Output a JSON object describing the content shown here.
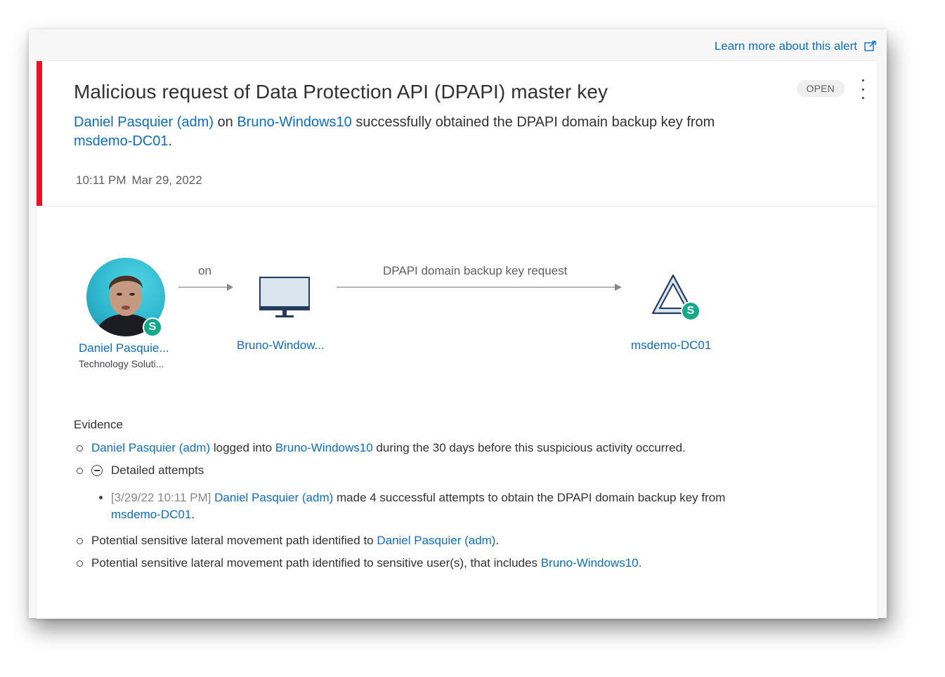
{
  "learn_more": {
    "label": "Learn more about this alert",
    "icon": "external-link-icon"
  },
  "alert": {
    "title": "Malicious request of Data Protection API (DPAPI) master key",
    "status": "OPEN",
    "more_icon": "more-vertical-icon",
    "severity_color": "#e81123",
    "description": {
      "user": "Daniel Pasquier (adm)",
      "on": " on ",
      "device": "Bruno-Windows10",
      "middle": " successfully obtained the DPAPI domain backup key from ",
      "target": "msdemo-DC01",
      "end": "."
    },
    "time": "10:11 PM",
    "date": "Mar 29, 2022"
  },
  "graph": {
    "user": {
      "name": "Daniel Pasquie...",
      "org": "Technology Soluti...",
      "badge": "S",
      "icon": "user-avatar"
    },
    "edge1": "on",
    "device": {
      "name": "Bruno-Window...",
      "icon": "monitor-icon"
    },
    "edge2": "DPAPI domain backup key request",
    "target": {
      "name": "msdemo-DC01",
      "badge": "S",
      "icon": "domain-controller-icon"
    }
  },
  "evidence": {
    "title": "Evidence",
    "item1": {
      "user": "Daniel Pasquier (adm)",
      "text1": " logged into ",
      "device": "Bruno-Windows10",
      "text2": " during the 30 days before this suspicious activity occurred."
    },
    "item2": {
      "label": "Detailed attempts",
      "icon": "collapse-minus-icon",
      "sub": {
        "timestamp": "[3/29/22 10:11 PM]",
        "user": "Daniel Pasquier (adm)",
        "text": " made 4 successful attempts to obtain the DPAPI domain backup key from ",
        "target": "msdemo-DC01",
        "end": "."
      }
    },
    "item3": {
      "text": "Potential sensitive lateral movement path identified to ",
      "user": "Daniel Pasquier (adm)",
      "end": "."
    },
    "item4": {
      "text": "Potential sensitive lateral movement path identified to sensitive user(s), that includes ",
      "device": "Bruno-Windows10",
      "end": "."
    }
  },
  "colors": {
    "link": "#0f6cbd",
    "badge": "#15a88a",
    "accent_red": "#e81123"
  }
}
